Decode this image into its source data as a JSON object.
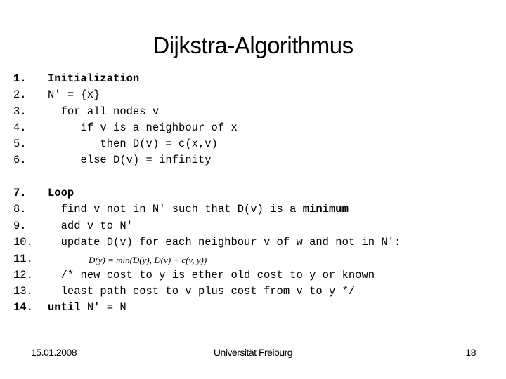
{
  "title": "Dijkstra-Algorithmus",
  "lines": [
    {
      "num": "1.",
      "indent": "",
      "parts": [
        {
          "text": "Initialization",
          "bold": true
        }
      ],
      "num_bold": true
    },
    {
      "num": "2.",
      "indent": "",
      "parts": [
        {
          "text": "N' = {x}"
        }
      ]
    },
    {
      "num": "3.",
      "indent": "  ",
      "parts": [
        {
          "text": "for all nodes v"
        }
      ]
    },
    {
      "num": "4.",
      "indent": "     ",
      "parts": [
        {
          "text": "if v is a neighbour of x"
        }
      ]
    },
    {
      "num": "5.",
      "indent": "        ",
      "parts": [
        {
          "text": "then D(v) = c(x,v)"
        }
      ]
    },
    {
      "num": "6.",
      "indent": "     ",
      "parts": [
        {
          "text": "else D(v) = infinity"
        }
      ]
    },
    {
      "num": "7.",
      "indent": "",
      "parts": [
        {
          "text": "Loop",
          "bold": true
        }
      ],
      "num_bold": true
    },
    {
      "num": "8.",
      "indent": "  ",
      "parts": [
        {
          "text": "find v not in N' such that D(v) is a "
        },
        {
          "text": "minimum",
          "bold": true
        }
      ]
    },
    {
      "num": "9.",
      "indent": "  ",
      "parts": [
        {
          "text": "add v to N'"
        }
      ]
    },
    {
      "num": "10.",
      "indent": "  ",
      "parts": [
        {
          "text": "update D(v) for each neighbour v of w and not in N':"
        }
      ]
    },
    {
      "num": "11.",
      "indent": "",
      "math": "D(y) = min(D(y), D(v) + c(v, y))"
    },
    {
      "num": "12.",
      "indent": "  ",
      "parts": [
        {
          "text": "/* new cost to y is ether old cost to y or known"
        }
      ]
    },
    {
      "num": "13.",
      "indent": "  ",
      "parts": [
        {
          "text": "least path cost to v plus cost from v to y */"
        }
      ]
    },
    {
      "num": "14.",
      "indent": "",
      "parts": [
        {
          "text": "until",
          "bold": true
        },
        {
          "text": " N' = N"
        }
      ],
      "num_bold": true
    }
  ],
  "footer": {
    "date": "15.01.2008",
    "organization": "Universität Freiburg",
    "page_number": "18"
  }
}
